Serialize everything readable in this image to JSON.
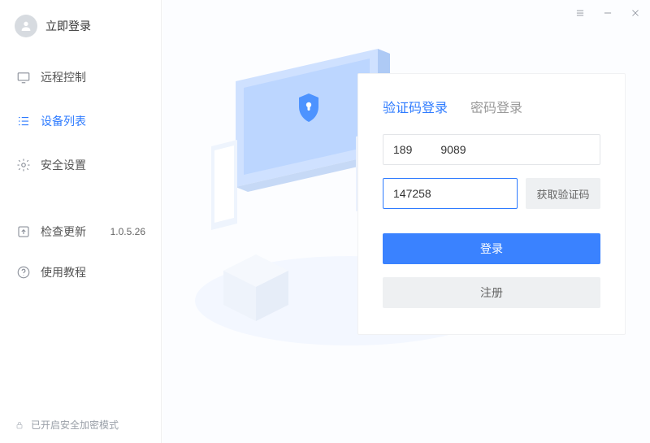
{
  "profile": {
    "login_now": "立即登录"
  },
  "nav": {
    "remote": "远程控制",
    "devices": "设备列表",
    "security": "安全设置"
  },
  "aux": {
    "update": "检查更新",
    "version": "1.0.5.26",
    "tutorial": "使用教程"
  },
  "footer": {
    "secure_mode": "已开启安全加密模式"
  },
  "login": {
    "tab_code": "验证码登录",
    "tab_pwd": "密码登录",
    "phone_value": "189         9089",
    "code_value": "147258",
    "get_code": "获取验证码",
    "submit": "登录",
    "register": "注册"
  }
}
